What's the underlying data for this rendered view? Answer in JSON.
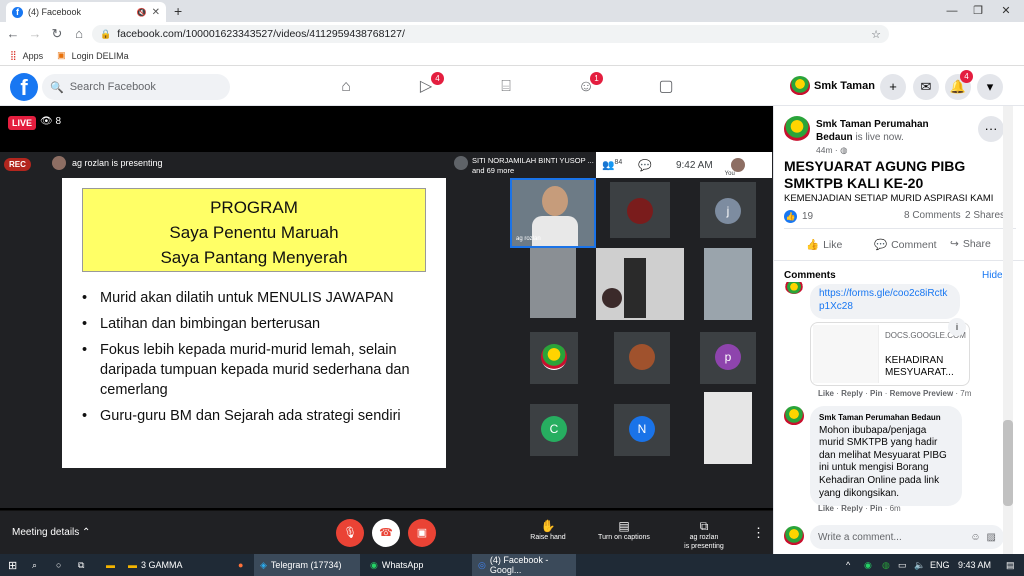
{
  "browser": {
    "tab_title": "(4) Facebook",
    "url": "facebook.com/100001623343527/videos/4112959438768127/",
    "bookmarks": [
      {
        "label": "Apps"
      },
      {
        "label": "Login DELIMa"
      }
    ]
  },
  "facebook": {
    "search_placeholder": "Search Facebook",
    "watch_badge": "4",
    "groups_badge": "1",
    "profile_name": "Smk Taman",
    "notif_badge": "4"
  },
  "video": {
    "live_label": "LIVE",
    "viewers": "8",
    "rec_label": "REC",
    "presenting_text": "ag rozlan is presenting",
    "presenter_top_name": "SITI NORJAMILAH BINTI YUSOP ...",
    "presenter_top_more": "and 69 more",
    "participants_count": "84",
    "time": "9:42 AM",
    "you_label": "You",
    "tile_label_self": "ag rozlan",
    "slide": {
      "title_lines": [
        "PROGRAM",
        "Saya Penentu Maruah",
        "Saya Pantang Menyerah"
      ],
      "bullets": [
        "Murid akan dilatih untuk MENULIS JAWAPAN",
        "Latihan dan bimbingan berterusan",
        "Fokus lebih kepada murid-murid lemah, selain daripada tumpuan kepada murid sederhana dan cemerlang",
        "Guru-guru BM dan Sejarah ada strategi sendiri"
      ]
    },
    "avatars": {
      "j": "j",
      "p": "p",
      "c": "C",
      "n": "N"
    },
    "controls": {
      "meeting_details": "Meeting details",
      "raise_hand": "Raise hand",
      "turn_on_captions": "Turn on captions",
      "presenting_line1": "ag rozlan",
      "presenting_line2": "is presenting"
    }
  },
  "post": {
    "page_name": "Smk Taman Perumahan Bedaun",
    "status_suffix": "is live now.",
    "time": "44m",
    "title": "MESYUARAT AGUNG PIBG SMKTPB KALI KE-20",
    "subtitle": "KEMENJADIAN SETIAP MURID ASPIRASI KAMI",
    "likes": "19",
    "comments_count": "8 Comments",
    "shares_count": "2 Shares",
    "like_label": "Like",
    "comment_label": "Comment",
    "share_label": "Share",
    "comments_header": "Comments",
    "hide_label": "Hide",
    "link_text": "https://forms.gle/coo2c8iRctkp1Xc28",
    "preview_domain": "DOCS.GOOGLE.COM",
    "preview_title": "KEHADIRAN MESYUARAT...",
    "meta1": {
      "like": "Like",
      "reply": "Reply",
      "pin": "Pin",
      "remove": "Remove Preview",
      "time": "7m"
    },
    "comment2_author": "Smk Taman Perumahan Bedaun",
    "comment2_text": "Mohon ibubapa/penjaga murid SMKTPB yang hadir dan melihat Mesyuarat PIBG ini untuk mengisi Borang Kehadiran Online pada link yang dikongsikan.",
    "meta2": {
      "like": "Like",
      "reply": "Reply",
      "pin": "Pin",
      "time": "6m"
    },
    "write_placeholder": "Write a comment..."
  },
  "taskbar": {
    "apps": [
      {
        "label": "3 GAMMA"
      },
      {
        "label": "Telegram (17734)"
      },
      {
        "label": "WhatsApp"
      },
      {
        "label": "(4) Facebook - Googl..."
      }
    ],
    "lang": "ENG",
    "clock": "9:43 AM"
  },
  "colors": {
    "fb_blue": "#1877f2",
    "live_red": "#e41e3f",
    "meet_dark": "#202124",
    "slide_yellow": "#ffff66"
  }
}
